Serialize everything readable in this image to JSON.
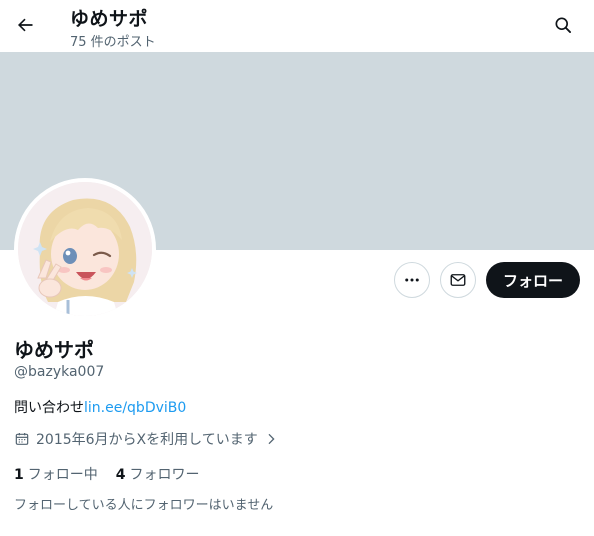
{
  "header": {
    "title": "ゆめサポ",
    "post_count": "75 件のポスト"
  },
  "icons": {
    "back": "arrow-left-icon",
    "search": "search-icon",
    "more": "more-horizontal-icon",
    "message": "envelope-icon",
    "calendar": "calendar-icon",
    "chevron": "chevron-right-icon"
  },
  "profile": {
    "display_name": "ゆめサポ",
    "handle": "@bazyka007",
    "bio_text": "問い合わせ",
    "bio_link": "lin.ee/qbDviB0",
    "joined": "2015年6月からXを利用しています",
    "following_count": "1",
    "following_label": "フォロー中",
    "followers_count": "4",
    "followers_label": "フォロワー",
    "no_known_followers": "フォローしている人にフォロワーはいません"
  },
  "actions": {
    "follow_label": "フォロー"
  },
  "colors": {
    "banner": "#cfd9de",
    "link": "#1d9bf0",
    "follow_button": "#0f1419",
    "secondary_text": "#536471"
  }
}
